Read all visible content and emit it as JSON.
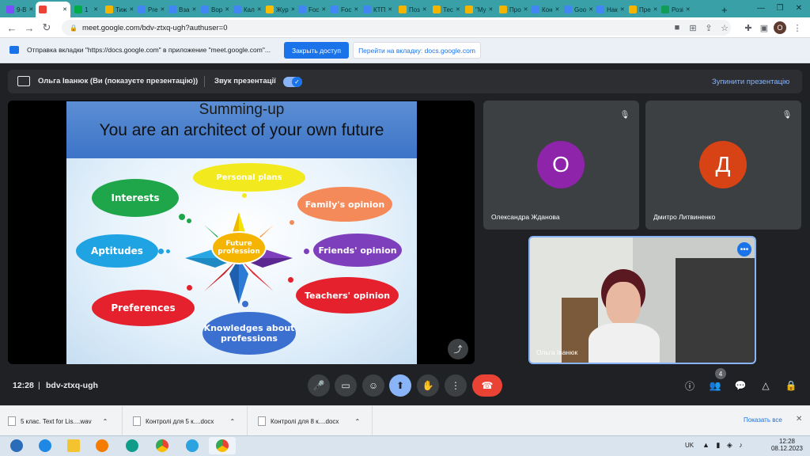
{
  "browser": {
    "tabs": [
      {
        "label": "9-В",
        "color": "#7c4dff"
      },
      {
        "label": "",
        "color": "#ea4335"
      },
      {
        "label": "1",
        "color": "#00ac47"
      },
      {
        "label": "Тиж",
        "color": "#f4b400"
      },
      {
        "label": "Pre",
        "color": "#4285f4"
      },
      {
        "label": "Вза",
        "color": "#4285f4"
      },
      {
        "label": "Вор",
        "color": "#4285f4"
      },
      {
        "label": "Кал",
        "color": "#4285f4"
      },
      {
        "label": "Жур",
        "color": "#fbbc04"
      },
      {
        "label": "Foc",
        "color": "#4285f4"
      },
      {
        "label": "Foc",
        "color": "#4285f4"
      },
      {
        "label": "КТП",
        "color": "#4285f4"
      },
      {
        "label": "Поз",
        "color": "#f4b400"
      },
      {
        "label": "Тес",
        "color": "#f4b400"
      },
      {
        "label": "\"My",
        "color": "#f4b400"
      },
      {
        "label": "Про",
        "color": "#f4b400"
      },
      {
        "label": "Кон",
        "color": "#4285f4"
      },
      {
        "label": "Goo",
        "color": "#4285f4"
      },
      {
        "label": "Нак",
        "color": "#4285f4"
      },
      {
        "label": "Пре",
        "color": "#f4b400"
      },
      {
        "label": "Розі",
        "color": "#0f9d58"
      }
    ],
    "new_tab": "+",
    "url": "meet.google.com/bdv-ztxq-ugh?authuser=0",
    "profile_initial": "О"
  },
  "infobar": {
    "message": "Отправка вкладки \"https://docs.google.com\" в приложение \"meet.google.com\"...",
    "share_button": "Закрыть доступ",
    "switch_button": "Перейти на вкладку: docs.google.com"
  },
  "presenting_bar": {
    "title": "Ольга Іванюк (Ви (показуєте презентацію))",
    "sound_label": "Звук презентації",
    "stop_label": "Зупинити презентацію"
  },
  "slide": {
    "title": "Summing-up",
    "subtitle": "You are  an architect of your own future",
    "center": "Future profession",
    "bubbles": {
      "personal_plans": "Personal plans",
      "interests": "Interests",
      "family": "Family's opinion",
      "aptitudes": "Aptitudes",
      "friends": "Friends' opinion",
      "preferences": "Preferences",
      "teachers": "Teachers' opinion",
      "knowledges": "Knowledges about professions"
    }
  },
  "participants": [
    {
      "name": "Олександра Жданова",
      "initial": "О",
      "color": "#8e24aa"
    },
    {
      "name": "Дмитро Литвиненко",
      "initial": "Д",
      "color": "#d84315"
    }
  ],
  "self_tile": {
    "name": "Ольга Іванюк"
  },
  "controls": {
    "time": "12:28",
    "meeting_code": "bdv-ztxq-ugh",
    "people_count": "4"
  },
  "downloads": {
    "items": [
      "5 клас. Text for Lis....wav",
      "Контролі для 5 к....docx",
      "Контролі для 8 к....docx"
    ],
    "show_all": "Показать все"
  },
  "taskbar": {
    "lang": "UK",
    "time": "12:28",
    "date": "08.12.2023"
  }
}
